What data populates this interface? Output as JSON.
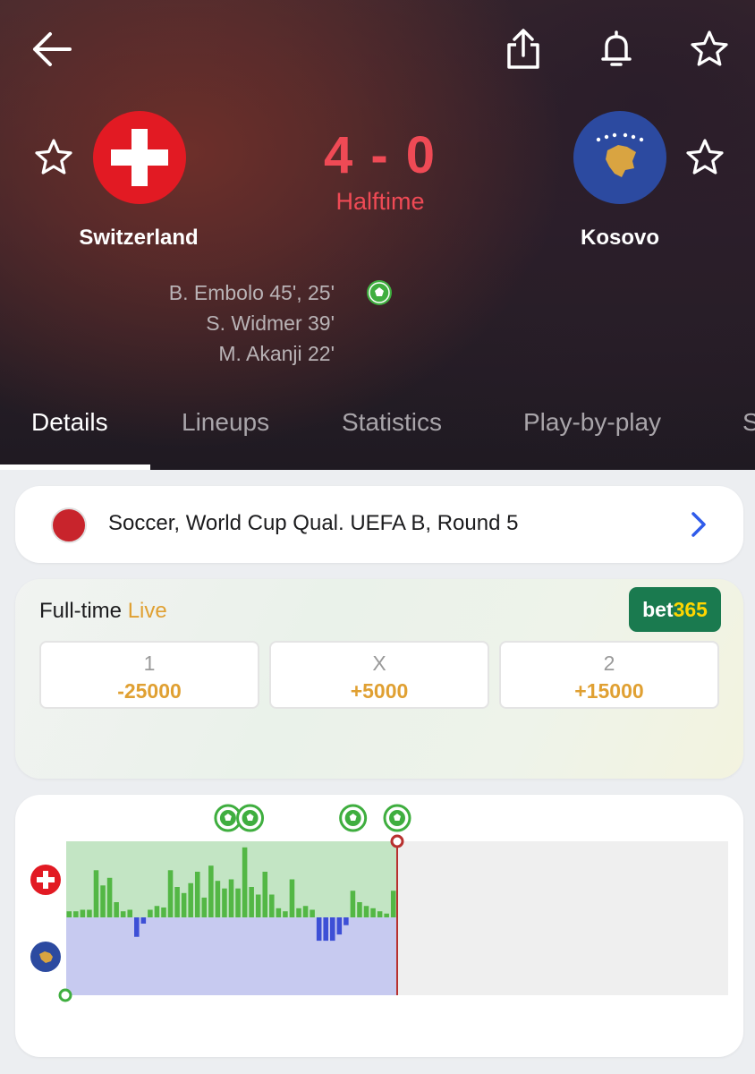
{
  "header": {
    "icons": [
      "back-arrow-icon",
      "share-icon",
      "bell-icon",
      "star-icon"
    ]
  },
  "match": {
    "home": {
      "name": "Switzerland",
      "flag": "switzerland-flag"
    },
    "away": {
      "name": "Kosovo",
      "flag": "kosovo-flag"
    },
    "score": "4 - 0",
    "status": "Halftime",
    "scorers": [
      "B. Embolo 45', 25'",
      "S. Widmer 39'",
      "M. Akanji 22'"
    ],
    "accent_color": "#ef4a55"
  },
  "tabs": [
    {
      "label": "Details",
      "active": true
    },
    {
      "label": "Lineups",
      "active": false
    },
    {
      "label": "Statistics",
      "active": false
    },
    {
      "label": "Play-by-play",
      "active": false
    },
    {
      "label": "S",
      "active": false
    }
  ],
  "competition": {
    "text": "Soccer, World Cup Qual. UEFA B, Round 5",
    "logo": "uefa-logo"
  },
  "odds": {
    "title": "Full-time",
    "live_label": "Live",
    "bookmaker_prefix": "bet",
    "bookmaker_suffix": "365",
    "options": [
      {
        "label": "1",
        "value": "-25000"
      },
      {
        "label": "X",
        "value": "+5000"
      },
      {
        "label": "2",
        "value": "+15000"
      }
    ]
  },
  "chart_data": {
    "type": "bar",
    "title": "",
    "x_range": [
      0,
      90
    ],
    "current_minute": 45,
    "y_range": [
      -1,
      1
    ],
    "home_color": "#53b745",
    "away_color": "#3d4fd6",
    "home_area_color": "#c3e5c4",
    "away_area_color": "#c7caf0",
    "pressure": [
      0.08,
      0.08,
      0.1,
      0.1,
      0.62,
      0.42,
      0.52,
      0.2,
      0.08,
      0.1,
      -0.25,
      -0.08,
      0.1,
      0.15,
      0.13,
      0.62,
      0.4,
      0.32,
      0.45,
      0.6,
      0.26,
      0.68,
      0.48,
      0.38,
      0.5,
      0.38,
      0.92,
      0.4,
      0.3,
      0.6,
      0.3,
      0.12,
      0.08,
      0.5,
      0.12,
      0.15,
      0.1,
      -0.3,
      -0.3,
      -0.3,
      -0.22,
      -0.1,
      0.35,
      0.2,
      0.15,
      0.12,
      0.08,
      0.05,
      0.35
    ],
    "goals": [
      {
        "team": "home",
        "minute": 22
      },
      {
        "team": "home",
        "minute": 25
      },
      {
        "team": "home",
        "minute": 39
      },
      {
        "team": "home",
        "minute": 45
      }
    ]
  }
}
